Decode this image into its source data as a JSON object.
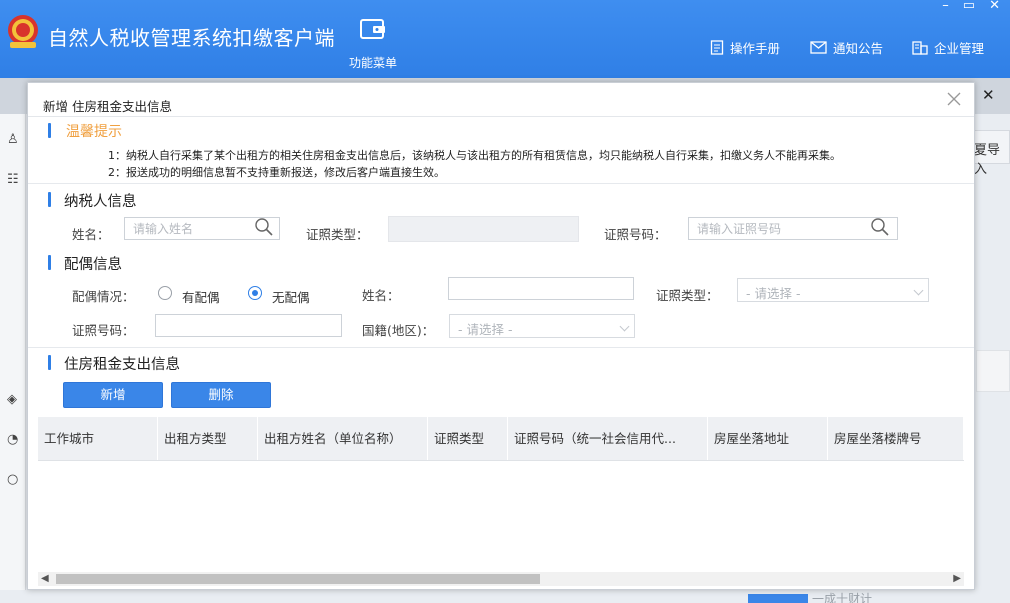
{
  "header": {
    "app_title": "自然人税收管理系统扣缴客户端",
    "func_menu_label": "功能菜单",
    "links": [
      "操作手册",
      "通知公告",
      "企业管理"
    ]
  },
  "background": {
    "right_button_text": "夏导入",
    "watermark": "一成十财计"
  },
  "modal": {
    "title": "新增 住房租金支出信息",
    "tip": {
      "title": "温馨提示",
      "lines": [
        "1：纳税人自行采集了某个出租方的相关住房租金支出信息后，该纳税人与该出租方的所有租赁信息，均只能纳税人自行采集，扣缴义务人不能再采集。",
        "2：报送成功的明细信息暂不支持重新报送，修改后客户端直接生效。"
      ]
    },
    "taxpayer": {
      "section_title": "纳税人信息",
      "name_label": "姓名：",
      "name_placeholder": "请输入姓名",
      "id_type_label": "证照类型：",
      "id_no_label": "证照号码：",
      "id_no_placeholder": "请输入证照号码"
    },
    "spouse": {
      "section_title": "配偶信息",
      "status_label": "配偶情况：",
      "option_yes": "有配偶",
      "option_no": "无配偶",
      "selected": "无配偶",
      "name_label": "姓名：",
      "id_type_label": "证照类型：",
      "id_type_placeholder": "- 请选择 -",
      "id_no_label": "证照号码：",
      "nationality_label": "国籍(地区)：",
      "nationality_placeholder": "- 请选择 -"
    },
    "rent": {
      "section_title": "住房租金支出信息",
      "add_label": "新增",
      "delete_label": "删除",
      "columns": [
        "工作城市",
        "出租方类型",
        "出租方姓名（单位名称）",
        "证照类型",
        "证照号码（统一社会信用代...",
        "房屋坐落地址",
        "房屋坐落楼牌号"
      ]
    }
  },
  "colors": {
    "header_blue": "#2f7fe6",
    "button_blue": "#3a86e8",
    "tip_orange": "#f0a040"
  }
}
